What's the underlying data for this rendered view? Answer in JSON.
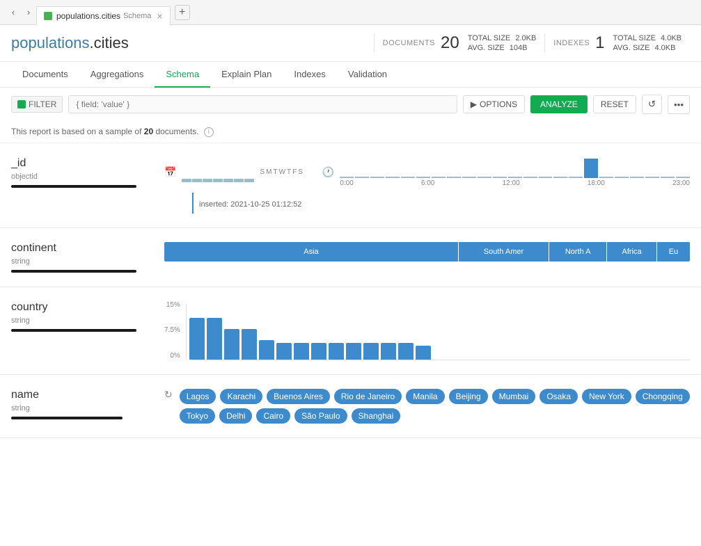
{
  "tabBar": {
    "navPrev": "‹",
    "navNext": "›",
    "tab": {
      "icon": "",
      "title": "populations.cities",
      "subtitle": "Schema",
      "close": "×"
    },
    "addTab": "+"
  },
  "header": {
    "dbName": "populations",
    "collectionName": ".cities",
    "documents": {
      "label": "DOCUMENTS",
      "value": "20"
    },
    "totalSize1": {
      "label": "TOTAL SIZE",
      "value": "2.0KB"
    },
    "avgSize1": {
      "label": "AVG. SIZE",
      "value": "104B"
    },
    "indexes": {
      "label": "INDEXES",
      "value": "1"
    },
    "totalSize2": {
      "label": "TOTAL SIZE",
      "value": "4.0KB"
    },
    "avgSize2": {
      "label": "AVG. SIZE",
      "value": "4.0KB"
    }
  },
  "navTabs": {
    "tabs": [
      {
        "label": "Documents"
      },
      {
        "label": "Aggregations"
      },
      {
        "label": "Schema"
      },
      {
        "label": "Explain Plan"
      },
      {
        "label": "Indexes"
      },
      {
        "label": "Validation"
      }
    ],
    "activeIndex": 2
  },
  "toolbar": {
    "filterLabel": "FILTER",
    "filterPlaceholder": "{ field: 'value' }",
    "optionsLabel": "OPTIONS",
    "analyzeLabel": "ANALYZE",
    "resetLabel": "RESET"
  },
  "sampleNotice": {
    "text1": "This report is based on a sample of ",
    "count": "20",
    "text2": " documents."
  },
  "fields": {
    "id": {
      "name": "_id",
      "type": "objectid",
      "insertedLabel": "inserted: 2021-10-25 01:12:52",
      "dayLabels": [
        "S",
        "M",
        "T",
        "W",
        "T",
        "F",
        "S"
      ],
      "timeLabels": [
        "0:00",
        "6:00",
        "12:00",
        "18:00",
        "23:00"
      ]
    },
    "continent": {
      "name": "continent",
      "type": "string",
      "segments": [
        {
          "label": "Asia",
          "flex": 7
        },
        {
          "label": "South Amer",
          "flex": 2
        },
        {
          "label": "North A",
          "flex": 1.2
        },
        {
          "label": "Africa",
          "flex": 1
        },
        {
          "label": "Eu",
          "flex": 0.6
        }
      ]
    },
    "country": {
      "name": "country",
      "type": "string",
      "yLabels": [
        "15%",
        "7.5%",
        "0%"
      ],
      "bars": [
        14,
        14,
        10,
        10,
        7,
        6,
        6,
        6,
        6,
        6,
        6,
        6,
        6,
        5
      ]
    },
    "name": {
      "name": "name",
      "type": "string",
      "tags": [
        "Lagos",
        "Karachi",
        "Buenos Aires",
        "Rio de Janeiro",
        "Manila",
        "Beijing",
        "Mumbai",
        "Osaka",
        "New York",
        "Chongqing",
        "Tokyo",
        "Delhi",
        "Cairo",
        "São Paulo",
        "Shanghai"
      ]
    }
  }
}
